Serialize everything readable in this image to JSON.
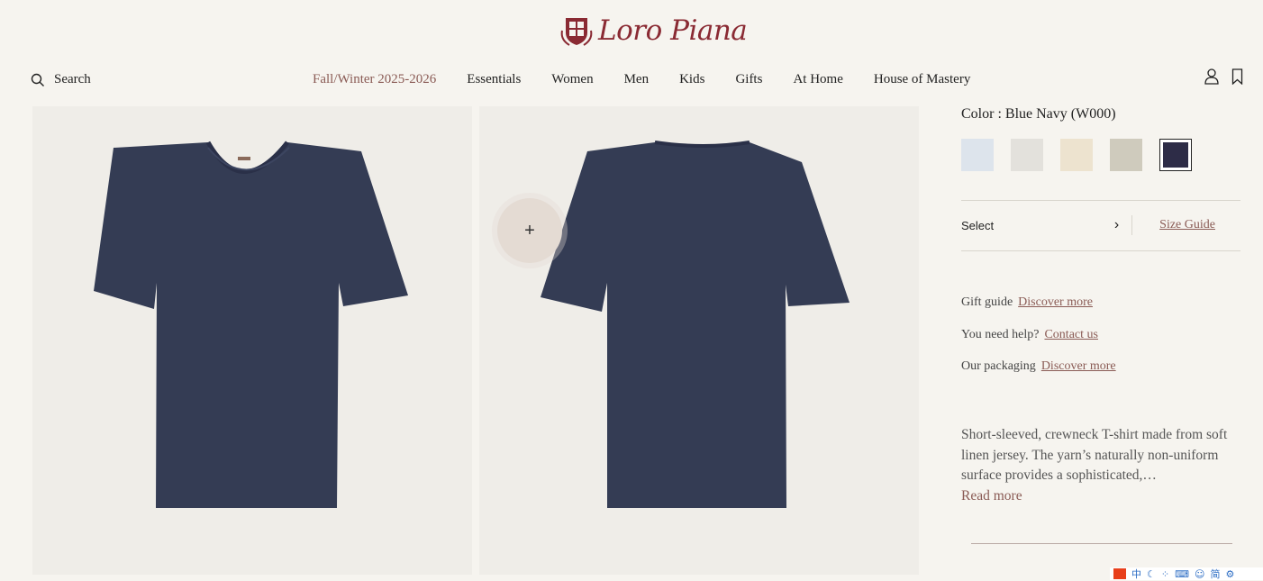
{
  "brand": {
    "name": "Loro Piana",
    "accent": "#8a2a33"
  },
  "header": {
    "search_label": "Search",
    "nav": [
      {
        "label": "Fall/Winter 2025-2026"
      },
      {
        "label": "Essentials"
      },
      {
        "label": "Women"
      },
      {
        "label": "Men"
      },
      {
        "label": "Kids"
      },
      {
        "label": "Gifts"
      },
      {
        "label": "At Home"
      },
      {
        "label": "House of Mastery"
      }
    ],
    "icons": [
      "account-icon",
      "bookmark-icon"
    ]
  },
  "gallery": {
    "images": [
      {
        "view": "front",
        "color": "#343c54"
      },
      {
        "view": "back",
        "color": "#343c54"
      }
    ],
    "zoom_symbol": "+"
  },
  "product": {
    "color_label": "Color : Blue Navy (W000)",
    "swatches": [
      {
        "name": "light blue",
        "color": "#dde4ec"
      },
      {
        "name": "light grey",
        "color": "#e3e1dc"
      },
      {
        "name": "cream",
        "color": "#ede3cf"
      },
      {
        "name": "taupe",
        "color": "#cfcbbd"
      },
      {
        "name": "Blue Navy",
        "color": "#2d2c47",
        "selected": true
      }
    ],
    "size_select_label": "Select",
    "size_guide_label": "Size Guide",
    "help": [
      {
        "text": "Gift guide",
        "link": "Discover more"
      },
      {
        "text": "You need help?",
        "link": "Contact us"
      },
      {
        "text": "Our packaging",
        "link": "Discover more"
      }
    ],
    "description": "Short-sleeved, crewneck T-shirt made from soft linen jersey. The yarn’s naturally non-uniform surface provides a sophisticated,…",
    "read_more": "Read more"
  },
  "taskbar": {
    "items": [
      "中",
      "简"
    ]
  }
}
